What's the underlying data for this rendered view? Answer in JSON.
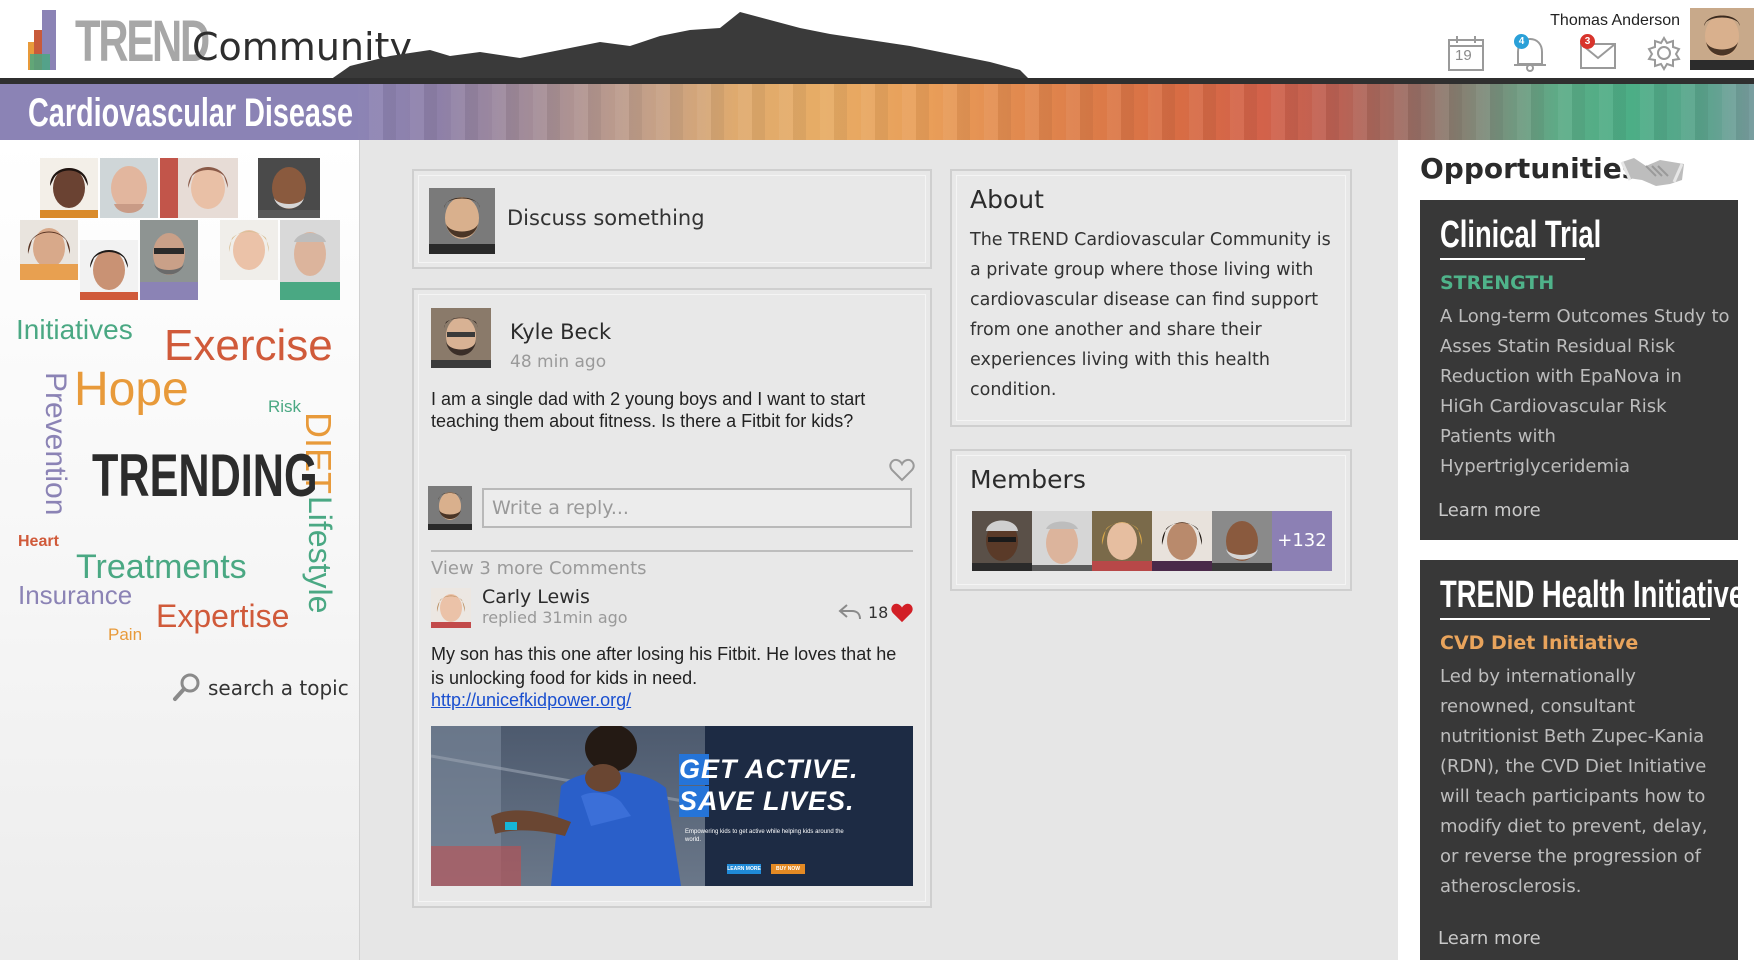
{
  "header": {
    "brand": "TREND",
    "community": "Community",
    "user_name": "Thomas Anderson",
    "calendar_day": "19",
    "notification_count": "4",
    "message_count": "3"
  },
  "banner": {
    "title": "Cardiovascular Disease"
  },
  "topic_cloud": {
    "words": {
      "initiatives": "Initiatives",
      "exercise": "Exercise",
      "prevention": "Prevention",
      "hope": "Hope",
      "risk": "Risk",
      "diet": "DIET",
      "trending": "TRENDING",
      "lifestyle": "Lifestyle",
      "heart": "Heart",
      "treatments": "Treatments",
      "insurance": "Insurance",
      "expertise": "Expertise",
      "pain": "Pain"
    },
    "search_label": "search a topic"
  },
  "discuss": {
    "label": "Discuss something"
  },
  "post": {
    "author": "Kyle Beck",
    "time": "48 min ago",
    "body": "I am a single dad with 2 young boys and I want to start teaching them about fitness. Is there a Fitbit for kids?",
    "reply_placeholder": "Write a reply...",
    "view_more": "View 3 more Comments",
    "comment": {
      "author": "Carly Lewis",
      "meta": "replied 31min ago",
      "likes": "18",
      "body": "My son has this one after losing his Fitbit. He loves that he is unlocking food for kids in need.",
      "link": "http://unicefkidpower.org/"
    },
    "promo": {
      "line1": "GET ACTIVE.",
      "line2": "SAVE LIVES.",
      "tagline": "Empowering kids to get active while helping kids around the world.",
      "btn1": "LEARN MORE",
      "btn2": "BUY NOW"
    }
  },
  "about": {
    "title": "About",
    "text": "The TREND Cardiovascular Community is a private group where those living with cardiovascular disease can find support from one another and share their experiences living with this health condition."
  },
  "members": {
    "title": "Members",
    "more": "+132"
  },
  "opportunities": {
    "title": "Opportunities",
    "cards": [
      {
        "title": "Clinical Trial",
        "subtitle": "STRENGTH",
        "subtitle_color": "#4fb38a",
        "text": "A Long-term Outcomes Study to Asses Statin Residual Risk Reduction with EpaNova in HiGh Cardiovascular Risk Patients with Hypertriglyceridemia",
        "link": "Learn more"
      },
      {
        "title": "TREND Health Initiative",
        "subtitle": "CVD Diet Initiative",
        "subtitle_color": "#e9a45c",
        "text": "Led by internationally renowned, consultant nutritionist Beth Zupec-Kania (RDN), the CVD Diet Initiative will teach participants how to modify diet to prevent, delay, or reverse the progression of atherosclerosis.",
        "link": "Learn more"
      }
    ]
  },
  "colors": {
    "banner_purple": "#8b83b5",
    "members_more_bg": "#8c80b4",
    "heart_red": "#d21f26",
    "badge_blue": "#2aa0d8",
    "badge_red": "#d8342c"
  },
  "icons": [
    "calendar-icon",
    "bell-icon",
    "mail-icon",
    "gear-icon",
    "search-icon",
    "heart-icon",
    "reply-icon",
    "handshake-icon"
  ]
}
